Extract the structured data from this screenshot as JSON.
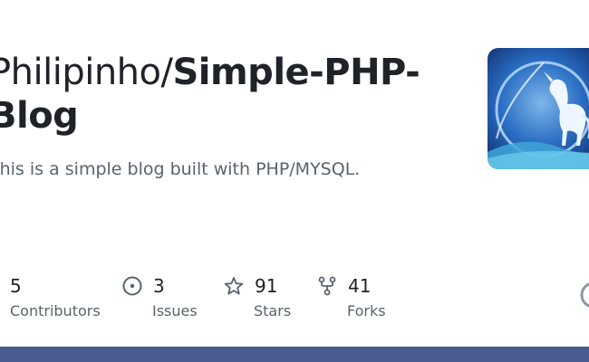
{
  "repo": {
    "owner": "Philipinho",
    "separator": "/",
    "name_part1": "Simple-PHP-",
    "name_part2": "Blog",
    "description": "This is a simple blog built with PHP/MYSQL."
  },
  "avatar": {
    "subject": "unicorn-on-moonlit-cliff"
  },
  "stats": [
    {
      "icon": "people-icon",
      "value": "5",
      "label": "Contributors"
    },
    {
      "icon": "issue-icon",
      "value": "3",
      "label": "Issues"
    },
    {
      "icon": "star-icon",
      "value": "91",
      "label": "Stars"
    },
    {
      "icon": "fork-icon",
      "value": "41",
      "label": "Forks"
    }
  ],
  "colors": {
    "text_primary": "#1f2328",
    "text_secondary": "#59636e",
    "bottom_bar": "#4b5a8f"
  }
}
